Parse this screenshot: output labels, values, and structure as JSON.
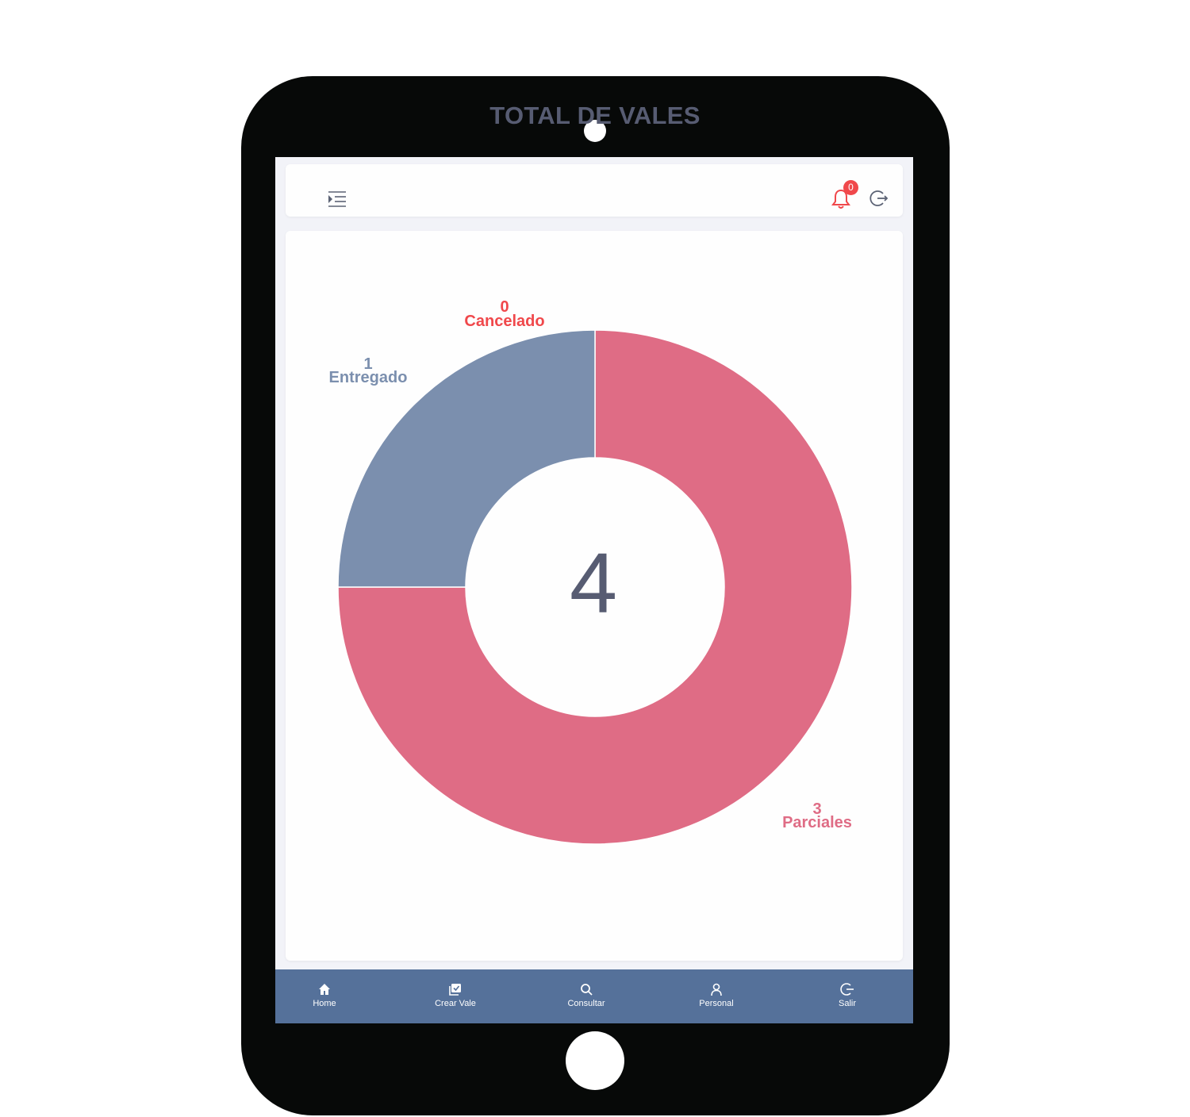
{
  "header": {
    "notification_count": "0"
  },
  "chart_data": {
    "type": "pie",
    "title": "TOTAL DE VALES",
    "center_total": "4",
    "slices": [
      {
        "label": "Parciales",
        "value": 3,
        "color": "#df6c85"
      },
      {
        "label": "Entregado",
        "value": 1,
        "color": "#7b8fae"
      },
      {
        "label": "Cancelado",
        "value": 0,
        "color": "#f0484b"
      }
    ]
  },
  "bottom_nav": {
    "items": [
      {
        "label": "Home",
        "icon": "home-icon"
      },
      {
        "label": "Crear Vale",
        "icon": "create-voucher-icon"
      },
      {
        "label": "Consultar",
        "icon": "search-icon"
      },
      {
        "label": "Personal",
        "icon": "user-icon"
      },
      {
        "label": "Salir",
        "icon": "logout-icon"
      }
    ]
  }
}
